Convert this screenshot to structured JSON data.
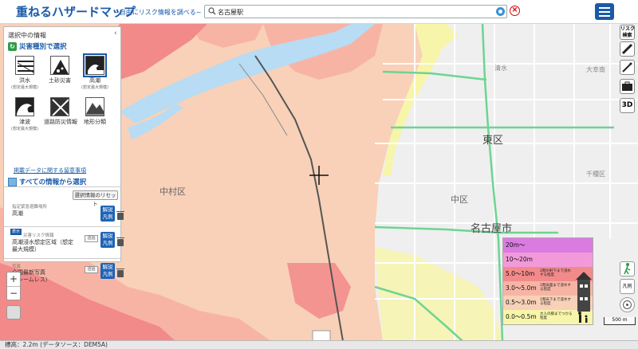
{
  "header": {
    "title": "重ねるハザードマップ",
    "subtitle": "~自由にリスク情報を調べる~",
    "search_value": "名古屋駅"
  },
  "panel": {
    "title": "選択中の情報",
    "select_by_hazard": "災害種別で選択",
    "hazards": [
      {
        "label": "洪水",
        "sub": "(想定最大規模)",
        "icon": "flood-icon",
        "selected": false
      },
      {
        "label": "土砂災害",
        "sub": "",
        "icon": "landslide-icon",
        "selected": false
      },
      {
        "label": "高潮",
        "sub": "(想定最大規模)",
        "icon": "storm-surge-icon",
        "selected": true
      },
      {
        "label": "津波",
        "sub": "(想定最大規模)",
        "icon": "tsunami-icon",
        "selected": false
      },
      {
        "label": "道路防災情報",
        "sub": "",
        "icon": "road-disaster-icon",
        "selected": false
      },
      {
        "label": "地形分類",
        "sub": "",
        "icon": "terrain-icon",
        "selected": false
      }
    ],
    "notice_link": "掲載データに関する留意事項",
    "select_all": "すべての情報から選択",
    "reset_label": "選択情報のリセット",
    "layers": [
      {
        "category": "指定緊急避難場所",
        "name": "高潮",
        "legend": "解説\n凡例",
        "transparency": ""
      },
      {
        "category": "災害リスク情報",
        "name": "高潮浸水想定区域（想定\n最大規模）",
        "legend": "解説\n凡例",
        "transparency": "透過",
        "show_tag": "表示"
      },
      {
        "category": "写真",
        "name": "全国最新写真\n（シームレス）",
        "legend": "解説\n凡例",
        "transparency": "透過"
      }
    ]
  },
  "map": {
    "labels": {
      "nakamura": "中村区",
      "higashi": "東区",
      "naka": "中区",
      "nagoya_city": "名古屋市",
      "shimizu": "清水",
      "daikancho": "大幸南",
      "kenchu": "千種区"
    },
    "colors": {
      "depth_0_05": "#f7f5a9",
      "depth_05_3": "#f8d1b8",
      "depth_3_5": "#f7b4a5",
      "depth_5_10": "#f28a8a",
      "depth_10_20": "#f29ad9",
      "depth_20_plus": "#db7be1",
      "rail_green": "#6ed492",
      "river": "#b7dcf4"
    }
  },
  "legend": {
    "rows": [
      {
        "range": "20m〜",
        "color": "#db7be1",
        "note": ""
      },
      {
        "range": "10〜20m",
        "color": "#f29ad9",
        "note": ""
      },
      {
        "range": "5.0〜10m",
        "color": "#f28a8a",
        "note": "2階の軒下まで浸水する程度"
      },
      {
        "range": "3.0〜5.0m",
        "color": "#f7b4a5",
        "note": "2階床面まで浸水する程度"
      },
      {
        "range": "0.5〜3.0m",
        "color": "#f8d1b8",
        "note": "1階床下まで浸水する程度"
      },
      {
        "range": "0.0〜0.5m",
        "color": "#f7f5a9",
        "note": "大人の膝までつかる程度"
      }
    ]
  },
  "right_tools": {
    "risk_label": "リスク\n検索",
    "threed": "3D",
    "legend_label": "凡例"
  },
  "scale_label": "500 m",
  "status_bar": "標高：2.2m (データソース：DEM5A)"
}
